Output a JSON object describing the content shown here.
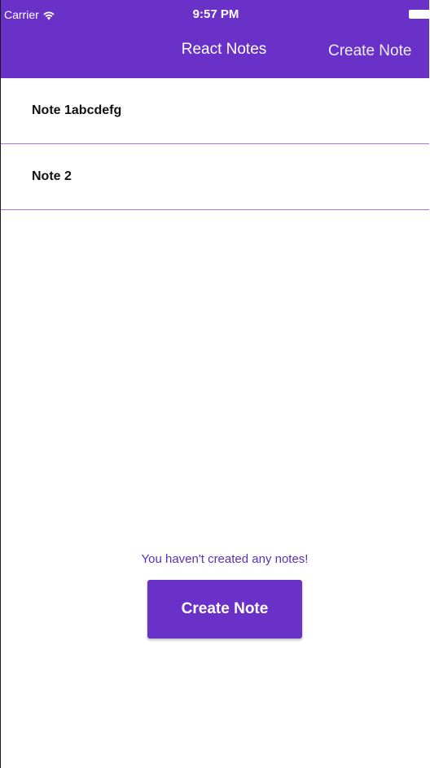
{
  "status_bar": {
    "carrier": "Carrier",
    "time": "9:57 PM",
    "wifi_icon": "wifi-icon",
    "battery_icon": "battery-icon"
  },
  "nav": {
    "title": "React Notes",
    "action_label": "Create Note"
  },
  "notes": [
    {
      "title": "Note 1abcdefg"
    },
    {
      "title": "Note 2"
    }
  ],
  "empty_state": {
    "message": "You haven't created any notes!",
    "button_label": "Create Note"
  },
  "colors": {
    "accent": "#6a31c8",
    "divider": "#9d7be0",
    "message_text": "#5a30b8"
  }
}
